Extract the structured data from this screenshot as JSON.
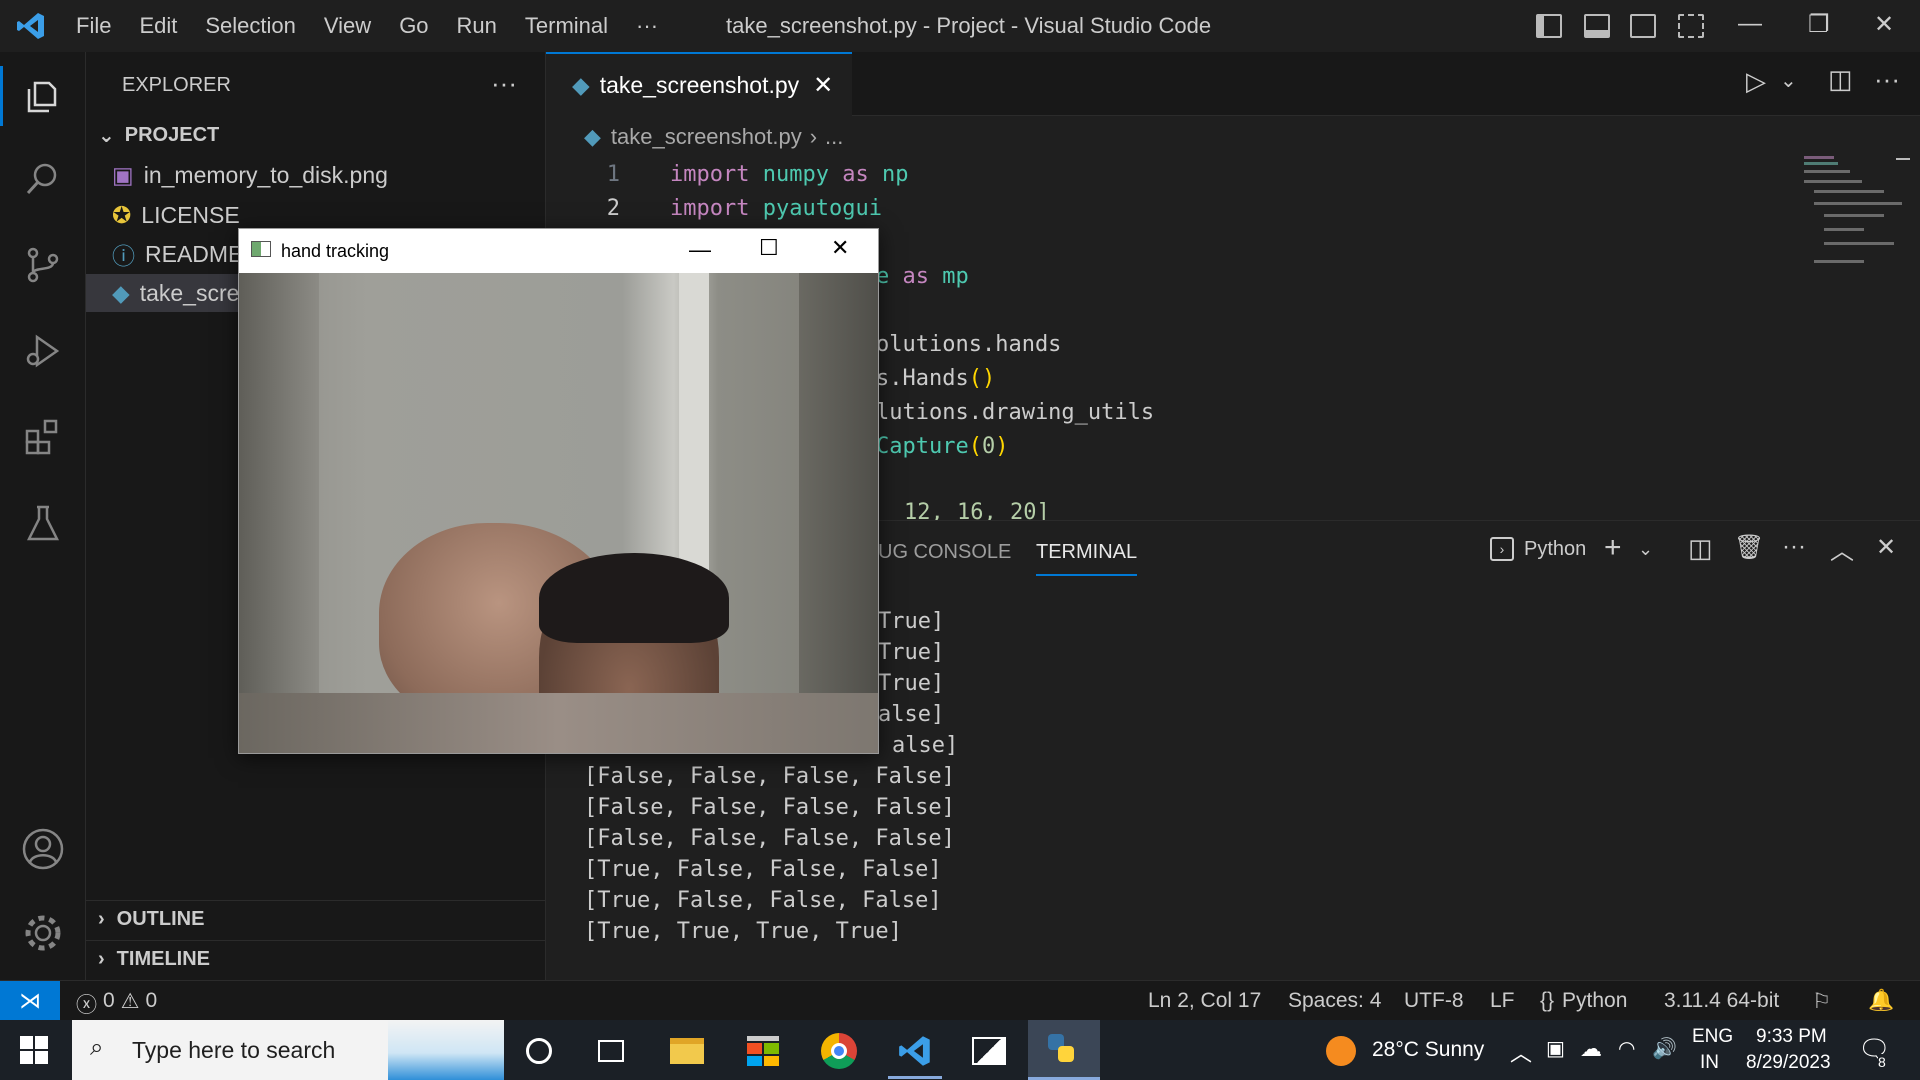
{
  "window": {
    "title": "take_screenshot.py - Project - Visual Studio Code",
    "menu": [
      "File",
      "Edit",
      "Selection",
      "View",
      "Go",
      "Run",
      "Terminal",
      "···"
    ]
  },
  "sidebar": {
    "header": "EXPLORER",
    "project_label": "PROJECT",
    "files": [
      {
        "name": "in_memory_to_disk.png",
        "icon": "image-file-icon"
      },
      {
        "name": "LICENSE",
        "icon": "license-icon"
      },
      {
        "name": "README.md",
        "icon": "info-icon"
      },
      {
        "name": "take_screenshot.py",
        "icon": "python-file-icon"
      }
    ],
    "outline_label": "OUTLINE",
    "timeline_label": "TIMELINE"
  },
  "editor": {
    "tab_label": "take_screenshot.py",
    "breadcrumb_file": "take_screenshot.py",
    "breadcrumb_rest": "...",
    "line_numbers": [
      "1",
      "2"
    ],
    "lines": [
      {
        "kw": "import",
        "mod": "numpy",
        "as": "as",
        "alias": "np"
      },
      {
        "kw": "import",
        "mod": "pyautogui"
      }
    ],
    "visible_fragments": [
      {
        "as": "as",
        "alias": "mp",
        "pre": "e"
      },
      {
        "text": "olutions.hands"
      },
      {
        "text": "s.Hands",
        "paren": "()"
      },
      {
        "text": "lutions.drawing_utils"
      },
      {
        "fn": "Capture",
        "paren_open": "(",
        "num": "0",
        "paren_close": ")"
      },
      {
        "text": "12, 16, 20]"
      }
    ]
  },
  "panel": {
    "tabs": [
      "UG CONSOLE",
      "TERMINAL"
    ],
    "active_tab": "TERMINAL",
    "terminal_profile": "Python",
    "output_partial": [
      "True]",
      "True]",
      "True]",
      "alse]",
      "alse]"
    ],
    "output": [
      "[False, False, False, False]",
      "[False, False, False, False]",
      "[False, False, False, False]",
      "[True, False, False, False]",
      "[True, False, False, False]",
      "[True, True, True, True]"
    ]
  },
  "statusbar": {
    "errors": "0",
    "warnings": "0",
    "position": "Ln 2, Col 17",
    "spaces": "Spaces: 4",
    "encoding": "UTF-8",
    "eol": "LF",
    "language": "Python",
    "interpreter": "3.11.4 64-bit"
  },
  "taskbar": {
    "search_placeholder": "Type here to search",
    "weather": "28°C  Sunny",
    "lang_top": "ENG",
    "lang_bottom": "IN",
    "time": "9:33 PM",
    "date": "8/29/2023",
    "notifications": "8"
  },
  "hand_window": {
    "title": "hand tracking"
  },
  "colors": {
    "accent": "#0078d4",
    "editor_bg": "#1f1f1f",
    "sidebar_bg": "#181818",
    "keyword": "#c586c0",
    "module": "#4ec9b0"
  }
}
